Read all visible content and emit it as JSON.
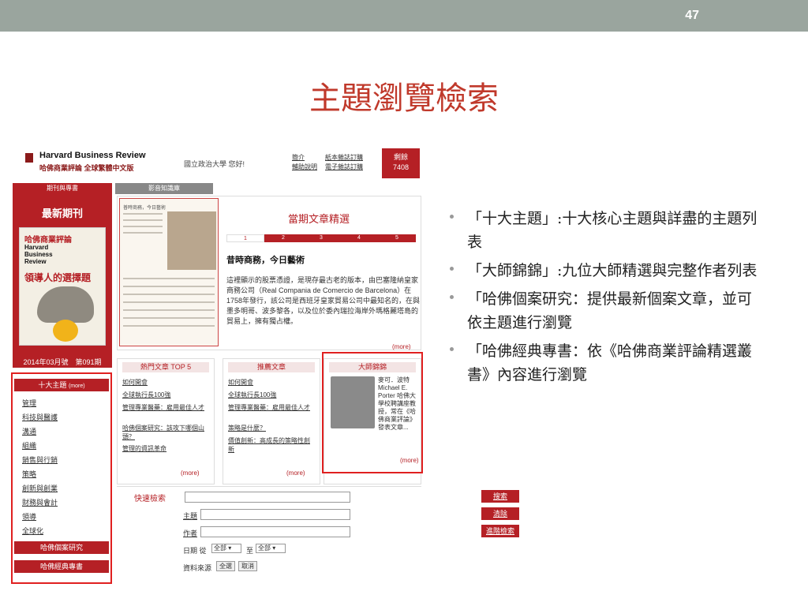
{
  "slide": {
    "number": "47",
    "title": "主題瀏覽檢索",
    "accent": "#c0392b",
    "bullets": [
      "「十大主題」:十大核心主題與詳盡的主題列表",
      "「大師錦錦」:九位大師精選與完整作者列表",
      "「哈佛個案研究：提供最新個案文章，並可依主題進行瀏覽",
      "「哈佛經典專書：依《哈佛商業評論精選叢書》內容進行瀏覽"
    ]
  },
  "site": {
    "brand": "Harvard Business Review",
    "brand_cn": "哈佛商業評論 全球繁體中文版",
    "greeting": "國立政治大學 您好!",
    "links": [
      "簡介",
      "紙本雜誌訂購",
      "輔助說明",
      "電子雜誌訂購"
    ],
    "credit": {
      "label": "剩餘",
      "value": "7408"
    },
    "tabs": [
      "期刊與專書",
      "影音知識庫"
    ],
    "latest_issue_title": "最新期刊",
    "cover": {
      "line1": "哈佛商業評論",
      "line2": "Harvard Business Review",
      "line3": "領導人的選擇題"
    },
    "issue": "2014年03月號　第091期",
    "feature": {
      "header": "當期文章精選",
      "thumb_title": "普時商務，今日藝術",
      "pages": [
        "1",
        "2",
        "3",
        "4",
        "5"
      ],
      "headline": "昔時商務，今日藝術",
      "body": "這裡顯示的股票憑證，是現存最古老的版本，由巴塞隆納皇家商務公司（Real Compania de Comercio de Barcelona）在1758年發行，該公司是西班牙皇家貿易公司中最知名的，在與墨多明哥、波多黎各，以及位於委內瑞拉海岸外瑪格麗塔島的貿易上，擁有獨占權。",
      "more": "(more)"
    },
    "popular": {
      "header": "熱門文章 TOP 5",
      "items": [
        "如何開會",
        "全球執行長100強",
        "管理專業醫藥：雇用最佳人才",
        "哈佛個案研究：該攻下哪個山頭？",
        "管理的資訊革命"
      ],
      "more": "(more)"
    },
    "recommended": {
      "header": "推薦文章",
      "items": [
        "如何開會",
        "全球執行長100強",
        "管理專業醫藥：雇用最佳人才",
        "策略是什麼？",
        "價值創新：高成長的策略性創新"
      ],
      "more": "(more)"
    },
    "masters": {
      "header": "大師錦錦",
      "text": "麥可．波特 Michael E. Porter 哈佛大學校聘講座教授，常在《哈佛商業評論》發表文章...",
      "more": "(more)"
    },
    "menu": {
      "head": "十大主題",
      "head_more": "(more)",
      "items": [
        "管理",
        "科技與醫護",
        "溝通",
        "組織",
        "銷售與行銷",
        "策略",
        "創新與創業",
        "財務與會計",
        "領導",
        "全球化"
      ],
      "case": "哈佛個案研究",
      "books": "哈佛經典專書"
    },
    "search": {
      "title": "快速檢索",
      "subject_label": "主題",
      "author_label": "作者",
      "date_label": "日期 從",
      "date_from": "全部",
      "date_to_label": "至",
      "date_to": "全部",
      "source_label": "資料來源",
      "select_all": "全選",
      "cancel": "取消",
      "btn_search": "搜索",
      "btn_clear": "清除",
      "btn_advanced": "進階檢索"
    }
  }
}
